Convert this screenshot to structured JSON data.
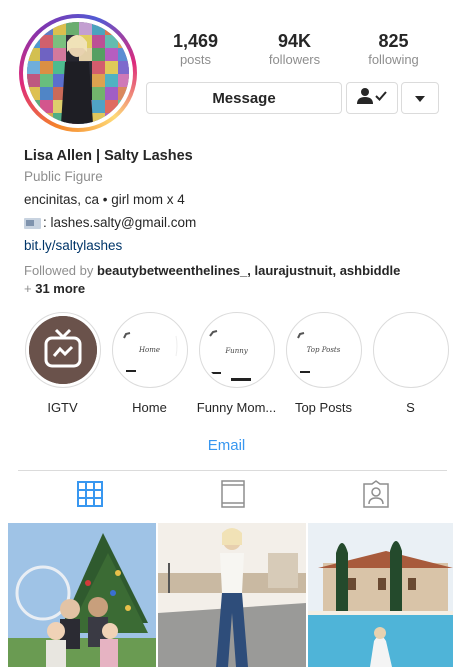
{
  "profile": {
    "stats": [
      {
        "value": "1,469",
        "label": "posts"
      },
      {
        "value": "94K",
        "label": "followers"
      },
      {
        "value": "825",
        "label": "following"
      }
    ],
    "message_label": "Message",
    "follow_icon": "person-check-icon",
    "more_icon": "chevron-down-icon"
  },
  "bio": {
    "name": "Lisa Allen | Salty Lashes",
    "category": "Public Figure",
    "tagline": "encinitas, ca • girl mom x 4",
    "email_line": ": lashes.salty@gmail.com",
    "link": "bit.ly/saltylashes",
    "followed_prefix": "Followed by ",
    "followed_names": "beautybetweenthelines_, laurajustnuit, ashbiddle",
    "followed_more_prefix": "+ ",
    "followed_more": "31 more"
  },
  "highlights": [
    {
      "label": "IGTV",
      "icon": "igtv-icon"
    },
    {
      "label": "Home",
      "cover_text": "Home"
    },
    {
      "label": "Funny Mom...",
      "cover_text": "Funny"
    },
    {
      "label": "Top Posts",
      "cover_text": "Top Posts"
    },
    {
      "label": "S",
      "cover_text": ""
    }
  ],
  "contact": {
    "email_label": "Email"
  },
  "tabs": [
    {
      "name": "grid",
      "icon": "grid-icon",
      "active": true
    },
    {
      "name": "igtv",
      "icon": "igtv-tab-icon",
      "active": false
    },
    {
      "name": "tagged",
      "icon": "tagged-person-icon",
      "active": false
    }
  ],
  "colors": {
    "link_blue": "#3897f0",
    "bio_link": "#003569",
    "muted": "#8e8e8e",
    "border": "#dbdbdb",
    "text": "#262626"
  }
}
